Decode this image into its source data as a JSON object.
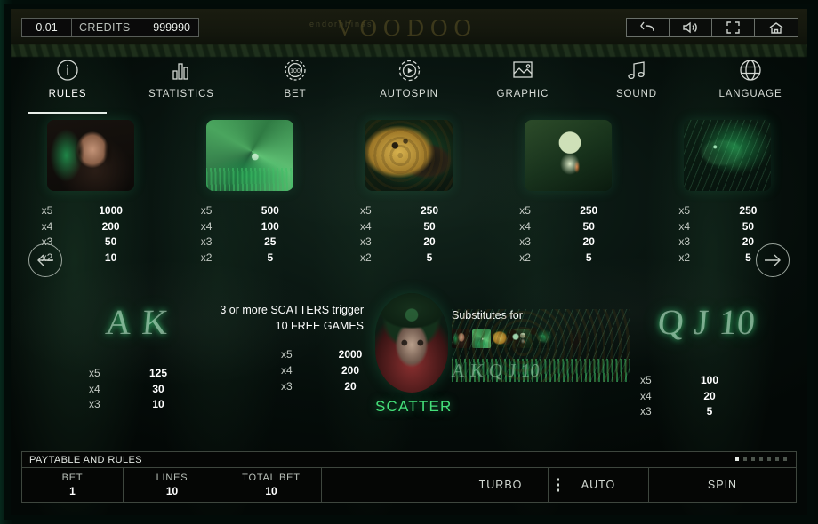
{
  "game": {
    "brand": "endorphinas",
    "title": "VOODOO"
  },
  "credits": {
    "denomination": "0.01",
    "label": "CREDITS",
    "value": "999990"
  },
  "window_buttons": [
    {
      "name": "back-button",
      "icon": "back-arrow-icon"
    },
    {
      "name": "sound-button",
      "icon": "speaker-icon"
    },
    {
      "name": "fullscreen-button",
      "icon": "expand-icon"
    },
    {
      "name": "home-button",
      "icon": "home-icon"
    }
  ],
  "tabs": [
    {
      "label": "RULES",
      "icon": "info-icon",
      "active": true
    },
    {
      "label": "STATISTICS",
      "icon": "bar-chart-icon",
      "active": false
    },
    {
      "label": "BET",
      "icon": "chip-icon",
      "active": false
    },
    {
      "label": "AUTOSPIN",
      "icon": "gear-play-icon",
      "active": false
    },
    {
      "label": "GRAPHIC",
      "icon": "image-icon",
      "active": false
    },
    {
      "label": "SOUND",
      "icon": "music-note-icon",
      "active": false
    },
    {
      "label": "LANGUAGE",
      "icon": "globe-icon",
      "active": false
    }
  ],
  "paytable": {
    "symbols": [
      {
        "name": "voodoo-woman",
        "art": "art-woman",
        "payouts": [
          {
            "mult": "x5",
            "amount": "1000"
          },
          {
            "mult": "x4",
            "amount": "200"
          },
          {
            "mult": "x3",
            "amount": "50"
          },
          {
            "mult": "x2",
            "amount": "10"
          }
        ]
      },
      {
        "name": "snake",
        "art": "art-snake",
        "payouts": [
          {
            "mult": "x5",
            "amount": "500"
          },
          {
            "mult": "x4",
            "amount": "100"
          },
          {
            "mult": "x3",
            "amount": "25"
          },
          {
            "mult": "x2",
            "amount": "5"
          }
        ]
      },
      {
        "name": "leopard",
        "art": "art-leopard",
        "payouts": [
          {
            "mult": "x5",
            "amount": "250"
          },
          {
            "mult": "x4",
            "amount": "50"
          },
          {
            "mult": "x3",
            "amount": "20"
          },
          {
            "mult": "x2",
            "amount": "5"
          }
        ]
      },
      {
        "name": "voodoo-doll",
        "art": "art-doll",
        "payouts": [
          {
            "mult": "x5",
            "amount": "250"
          },
          {
            "mult": "x4",
            "amount": "50"
          },
          {
            "mult": "x3",
            "amount": "20"
          },
          {
            "mult": "x2",
            "amount": "5"
          }
        ]
      },
      {
        "name": "raven",
        "art": "art-raven",
        "payouts": [
          {
            "mult": "x5",
            "amount": "250"
          },
          {
            "mult": "x4",
            "amount": "50"
          },
          {
            "mult": "x3",
            "amount": "20"
          },
          {
            "mult": "x2",
            "amount": "5"
          }
        ]
      }
    ],
    "letter_group_high": {
      "glyphs": [
        "A",
        "K"
      ],
      "payouts": [
        {
          "mult": "x5",
          "amount": "125"
        },
        {
          "mult": "x4",
          "amount": "30"
        },
        {
          "mult": "x3",
          "amount": "10"
        }
      ]
    },
    "letter_group_low": {
      "glyphs": [
        "Q",
        "J",
        "10"
      ],
      "payouts": [
        {
          "mult": "x5",
          "amount": "100"
        },
        {
          "mult": "x4",
          "amount": "20"
        },
        {
          "mult": "x3",
          "amount": "5"
        }
      ]
    },
    "scatter": {
      "line1": "3 or more SCATTERS trigger",
      "line2": "10 FREE GAMES",
      "label": "SCATTER",
      "label_color": "#45e07a",
      "payouts": [
        {
          "mult": "x5",
          "amount": "2000"
        },
        {
          "mult": "x4",
          "amount": "200"
        },
        {
          "mult": "x3",
          "amount": "20"
        }
      ]
    },
    "wild": {
      "title": "Substitutes for",
      "symbol_thumbs": [
        "voodoo-woman",
        "snake",
        "leopard",
        "voodoo-doll",
        "raven"
      ],
      "letters": [
        "A",
        "K",
        "Q",
        "J",
        "10"
      ]
    }
  },
  "nav": {
    "prev_icon": "arrow-left-icon",
    "next_icon": "arrow-right-icon"
  },
  "bottom": {
    "title": "PAYTABLE AND RULES",
    "pagination": {
      "total": 7,
      "active_index": 0
    },
    "bet_label": "BET",
    "bet_value": "1",
    "lines_label": "LINES",
    "lines_value": "10",
    "total_bet_label": "TOTAL BET",
    "total_bet_value": "10",
    "turbo_label": "TURBO",
    "auto_label": "AUTO",
    "spin_label": "SPIN"
  }
}
